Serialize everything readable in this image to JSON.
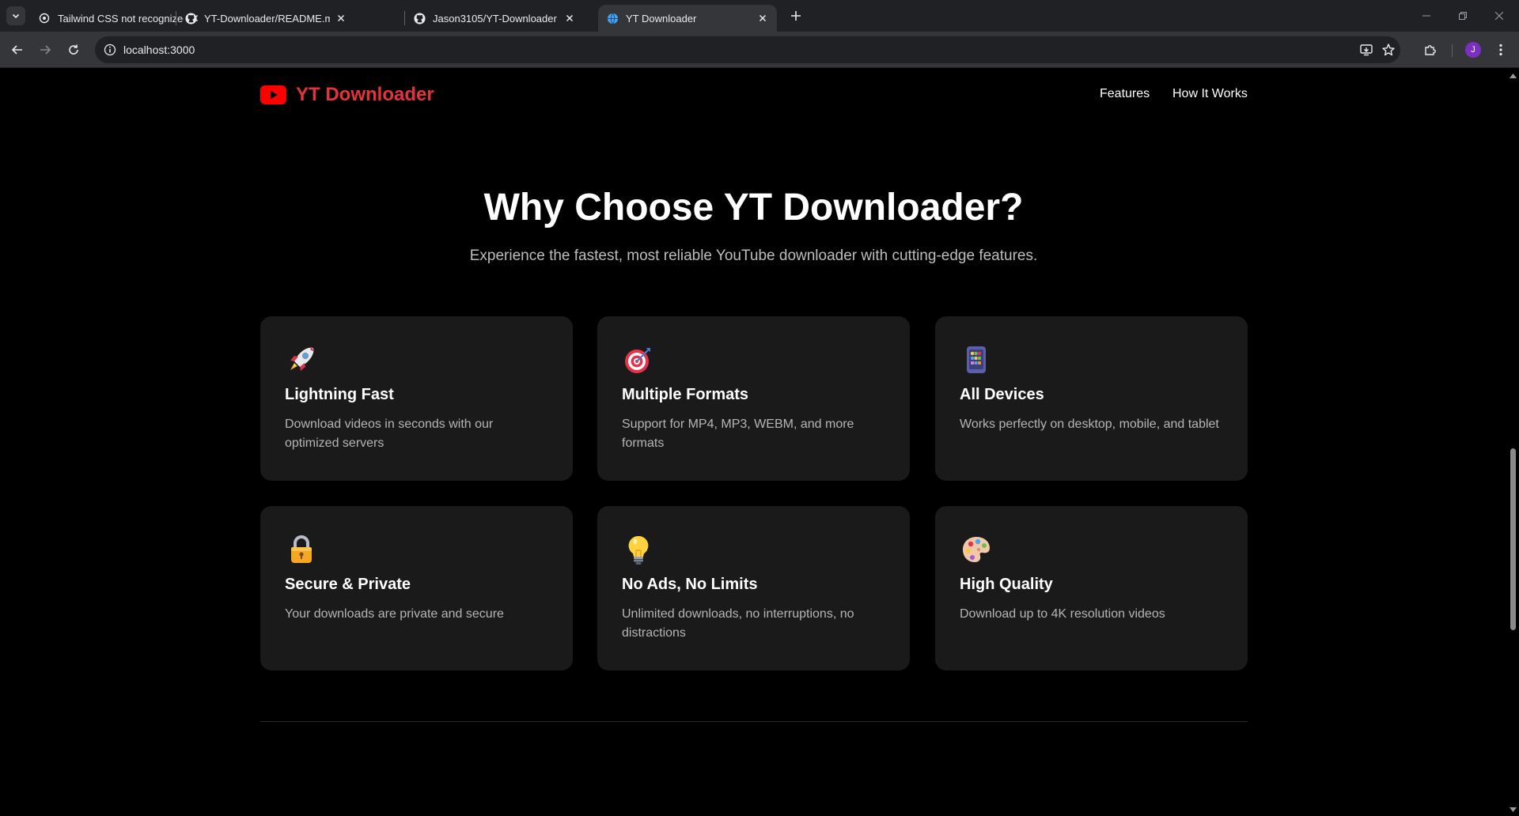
{
  "browser": {
    "tabs": [
      {
        "title": "Tailwind CSS not recognized",
        "favicon": "openai-icon"
      },
      {
        "title": "YT-Downloader/README.md at",
        "favicon": "github-icon"
      },
      {
        "title": "Jason3105/YT-Downloader",
        "favicon": "github-icon"
      },
      {
        "title": "YT Downloader",
        "favicon": "globe-icon",
        "active": true
      }
    ],
    "url": "localhost:3000",
    "profile_initial": "J"
  },
  "site": {
    "brand": "YT Downloader",
    "brand_color": "#e5323b",
    "nav": [
      {
        "label": "Features"
      },
      {
        "label": "How It Works"
      }
    ]
  },
  "hero": {
    "title": "Why Choose YT Downloader?",
    "subtitle": "Experience the fastest, most reliable YouTube downloader with cutting-edge features."
  },
  "features": [
    {
      "icon": "rocket-icon",
      "title": "Lightning Fast",
      "desc": "Download videos in seconds with our optimized servers"
    },
    {
      "icon": "target-icon",
      "title": "Multiple Formats",
      "desc": "Support for MP4, MP3, WEBM, and more formats"
    },
    {
      "icon": "mobile-device-icon",
      "title": "All Devices",
      "desc": "Works perfectly on desktop, mobile, and tablet"
    },
    {
      "icon": "lock-icon",
      "title": "Secure & Private",
      "desc": "Your downloads are private and secure"
    },
    {
      "icon": "lightbulb-icon",
      "title": "No Ads, No Limits",
      "desc": "Unlimited downloads, no interruptions, no distractions"
    },
    {
      "icon": "palette-icon",
      "title": "High Quality",
      "desc": "Download up to 4K resolution videos"
    }
  ]
}
